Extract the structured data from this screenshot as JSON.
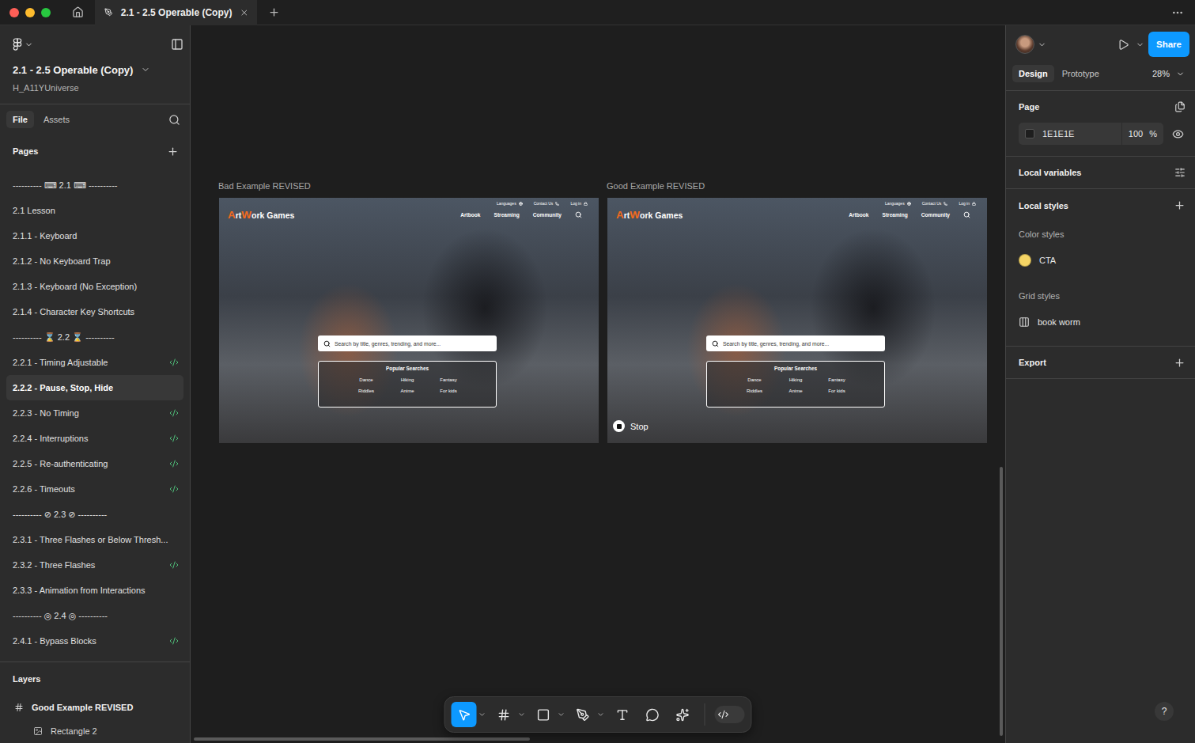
{
  "title_bar": {
    "tabs": [
      {
        "label": "2.1 - 2.5 Operable (Copy)",
        "selected": true
      }
    ]
  },
  "sidebar": {
    "file_title": "2.1 - 2.5 Operable (Copy)",
    "team": "H_A11YUniverse",
    "tabs": [
      {
        "label": "File",
        "selected": true
      },
      {
        "label": "Assets",
        "selected": false
      }
    ],
    "pages_title": "Pages",
    "pages": [
      {
        "label": "---------- ⌨ 2.1 ⌨ ----------",
        "selected": false,
        "dev_ready": false
      },
      {
        "label": "2.1 Lesson",
        "selected": false,
        "dev_ready": false
      },
      {
        "label": "2.1.1 - Keyboard",
        "selected": false,
        "dev_ready": false
      },
      {
        "label": "2.1.2 - No Keyboard Trap",
        "selected": false,
        "dev_ready": false
      },
      {
        "label": "2.1.3 - Keyboard (No Exception)",
        "selected": false,
        "dev_ready": false
      },
      {
        "label": "2.1.4 - Character Key Shortcuts",
        "selected": false,
        "dev_ready": false
      },
      {
        "label": "---------- ⌛ 2.2 ⌛ ----------",
        "selected": false,
        "dev_ready": false
      },
      {
        "label": "2.2.1 - Timing Adjustable",
        "selected": false,
        "dev_ready": true
      },
      {
        "label": "2.2.2 - Pause, Stop, Hide",
        "selected": true,
        "dev_ready": false
      },
      {
        "label": "2.2.3 - No Timing",
        "selected": false,
        "dev_ready": true
      },
      {
        "label": "2.2.4 - Interruptions",
        "selected": false,
        "dev_ready": true
      },
      {
        "label": "2.2.5 - Re-authenticating",
        "selected": false,
        "dev_ready": true
      },
      {
        "label": "2.2.6 - Timeouts",
        "selected": false,
        "dev_ready": true
      },
      {
        "label": "---------- ⊘ 2.3 ⊘ ----------",
        "selected": false,
        "dev_ready": false
      },
      {
        "label": "2.3.1 - Three Flashes or Below Thresh...",
        "selected": false,
        "dev_ready": false
      },
      {
        "label": "2.3.2 - Three Flashes",
        "selected": false,
        "dev_ready": true
      },
      {
        "label": "2.3.3 - Animation from Interactions",
        "selected": false,
        "dev_ready": false
      },
      {
        "label": "---------- ◎ 2.4 ◎ ----------",
        "selected": false,
        "dev_ready": false
      },
      {
        "label": "2.4.1 - Bypass Blocks",
        "selected": false,
        "dev_ready": true
      }
    ],
    "layers_title": "Layers",
    "layers": [
      {
        "label": "Good Example REVISED",
        "kind": "frame",
        "nested": false
      },
      {
        "label": "Rectangle 2",
        "kind": "image",
        "nested": true
      }
    ]
  },
  "canvas": {
    "frames": [
      {
        "label": "Bad Example REVISED",
        "stop_button": false
      },
      {
        "label": "Good Example REVISED",
        "stop_button": true
      }
    ],
    "mockup": {
      "logo": [
        {
          "text": "A",
          "accent": true
        },
        {
          "text": "rt",
          "accent": false
        },
        {
          "text": "W",
          "accent": true
        },
        {
          "text": "ork Games",
          "accent": false
        }
      ],
      "utility_links": [
        {
          "label": "Languages",
          "kind": "globe"
        },
        {
          "label": "Contact Us",
          "kind": "phone"
        },
        {
          "label": "Log in",
          "kind": "lock"
        }
      ],
      "nav": [
        "Artbook",
        "Streaming",
        "Community"
      ],
      "search_placeholder": "Search by title, genres, trending, and more...",
      "popular_title": "Popular Searches",
      "popular": [
        "Dance",
        "Hiking",
        "Fantasy",
        "Riddles",
        "Anime",
        "For kids"
      ],
      "stop_label": "Stop"
    }
  },
  "toolbar": {
    "tools": [
      {
        "kind": "move",
        "selected": true,
        "menu": true
      },
      {
        "kind": "frame",
        "selected": false,
        "menu": true
      },
      {
        "kind": "shape",
        "selected": false,
        "menu": true
      },
      {
        "kind": "pen",
        "selected": false,
        "menu": true
      },
      {
        "kind": "text",
        "selected": false,
        "menu": false
      },
      {
        "kind": "comment",
        "selected": false,
        "menu": false
      },
      {
        "kind": "ai",
        "selected": false,
        "menu": false
      }
    ],
    "dev_mode": false
  },
  "inspector": {
    "share": "Share",
    "tabs": [
      {
        "label": "Design",
        "selected": true
      },
      {
        "label": "Prototype",
        "selected": false
      }
    ],
    "zoom": "28%",
    "page": {
      "title": "Page",
      "fill": "1E1E1E",
      "opacity": "100",
      "unit": "%",
      "visible": true
    },
    "local_variables": "Local variables",
    "local_styles": {
      "title": "Local styles",
      "groups": [
        {
          "title": "Color styles",
          "items": [
            {
              "label": "CTA",
              "kind": "color",
              "color": "#f5d565"
            }
          ]
        },
        {
          "title": "Grid styles",
          "items": [
            {
              "label": "book worm",
              "kind": "grid"
            }
          ]
        }
      ]
    },
    "export": "Export",
    "help": "?"
  }
}
